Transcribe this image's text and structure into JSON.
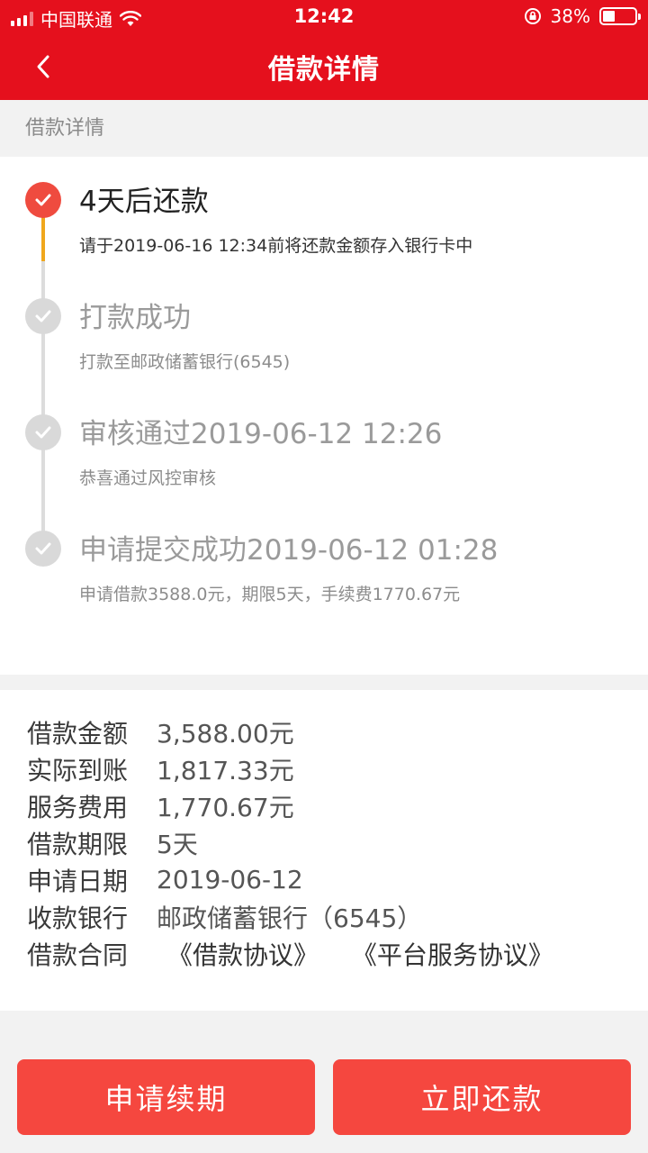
{
  "status_bar": {
    "carrier": "中国联通",
    "time": "12:42",
    "battery": "38%",
    "battery_level": 0.38
  },
  "nav": {
    "title": "借款详情"
  },
  "section_label": "借款详情",
  "timeline": {
    "steps": [
      {
        "title": "4天后还款",
        "desc": "请于2019-06-16 12:34前将还款金额存入银行卡中",
        "active": true
      },
      {
        "title": "打款成功",
        "desc": "打款至邮政储蓄银行(6545)",
        "active": false
      },
      {
        "title": "审核通过2019-06-12 12:26",
        "desc": "恭喜通过风控审核",
        "active": false
      },
      {
        "title": "申请提交成功2019-06-12 01:28",
        "desc": "申请借款3588.0元，期限5天，手续费1770.67元",
        "active": false
      }
    ]
  },
  "info": {
    "rows": [
      {
        "label": "借款金额",
        "value": "3,588.00元"
      },
      {
        "label": "实际到账",
        "value": "1,817.33元"
      },
      {
        "label": "服务费用",
        "value": "1,770.67元"
      },
      {
        "label": "借款期限",
        "value": "5天"
      },
      {
        "label": "申请日期",
        "value": "2019-06-12"
      },
      {
        "label": "收款银行",
        "value": "邮政储蓄银行（6545）"
      }
    ],
    "contract": {
      "label": "借款合同",
      "links": [
        "《借款协议》",
        "《平台服务协议》"
      ]
    }
  },
  "buttons": {
    "renew": "申请续期",
    "repay": "立即还款"
  },
  "colors": {
    "header": "#e5101d",
    "button": "#f5473f",
    "active_dot": "#ef4b3f",
    "active_rail": "#f0a71c",
    "inactive": "#d9d9d9"
  }
}
